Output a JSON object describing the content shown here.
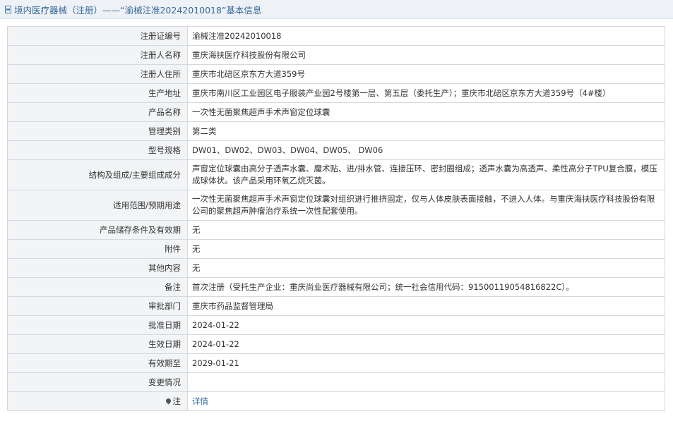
{
  "header": {
    "title": "境内医疗器械（注册）——“渝械注准20242010018”基本信息",
    "icon": "document-icon",
    "accent_color": "#356aa0"
  },
  "rows": [
    {
      "key": "reg-no",
      "label": "注册证编号",
      "value": "渝械注准20242010018"
    },
    {
      "key": "registrant-name",
      "label": "注册人名称",
      "value": "重庆海扶医疗科技股份有限公司"
    },
    {
      "key": "registrant-address",
      "label": "注册人住所",
      "value": "重庆市北碚区京东方大道359号"
    },
    {
      "key": "production-address",
      "label": "生产地址",
      "value": "重庆市南川区工业园区电子服装产业园2号楼第一层、第五层（委托生产）；重庆市北碚区京东方大道359号（4#楼）"
    },
    {
      "key": "product-name",
      "label": "产品名称",
      "value": "一次性无菌聚焦超声手术声窗定位球囊"
    },
    {
      "key": "management-class",
      "label": "管理类别",
      "value": "第二类"
    },
    {
      "key": "model-spec",
      "label": "型号规格",
      "value": "DW01、DW02、DW03、DW04、DW05、 DW06"
    },
    {
      "key": "structure",
      "label": "结构及组成/主要组成成分",
      "value": "声窗定位球囊由高分子透声水囊、魔术贴、进/排水管、连接压环、密封圈组成；透声水囊为高透声、柔性高分子TPU复合膜，模压成球体状。该产品采用环氧乙烷灭菌。",
      "tall": true
    },
    {
      "key": "intended-use",
      "label": "适用范围/预期用途",
      "value": "一次性无菌聚焦超声手术声窗定位球囊对组织进行推挤固定，仅与人体皮肤表面接触，不进入人体。与重庆海扶医疗科技股份有限公司的聚焦超声肿瘤治疗系统一次性配套使用。",
      "tall": true
    },
    {
      "key": "storage",
      "label": "产品储存条件及有效期",
      "value": "无"
    },
    {
      "key": "attachment",
      "label": "附件",
      "value": "无"
    },
    {
      "key": "other-content",
      "label": "其他内容",
      "value": "无"
    },
    {
      "key": "remarks",
      "label": "备注",
      "value": "首次注册（受托生产企业：重庆尚业医疗器械有限公司；统一社会信用代码：91500119054816822C）。"
    },
    {
      "key": "approval-dept",
      "label": "审批部门",
      "value": "重庆市药品监督管理局"
    },
    {
      "key": "approval-date",
      "label": "批准日期",
      "value": "2024-01-22"
    },
    {
      "key": "effective-date",
      "label": "生效日期",
      "value": "2024-01-22"
    },
    {
      "key": "expiry-date",
      "label": "有效期至",
      "value": "2029-01-21"
    },
    {
      "key": "change-info",
      "label": "变更情况",
      "value": ""
    }
  ],
  "note": {
    "label": "注",
    "icon": "pin-icon",
    "link_text": "详情"
  }
}
